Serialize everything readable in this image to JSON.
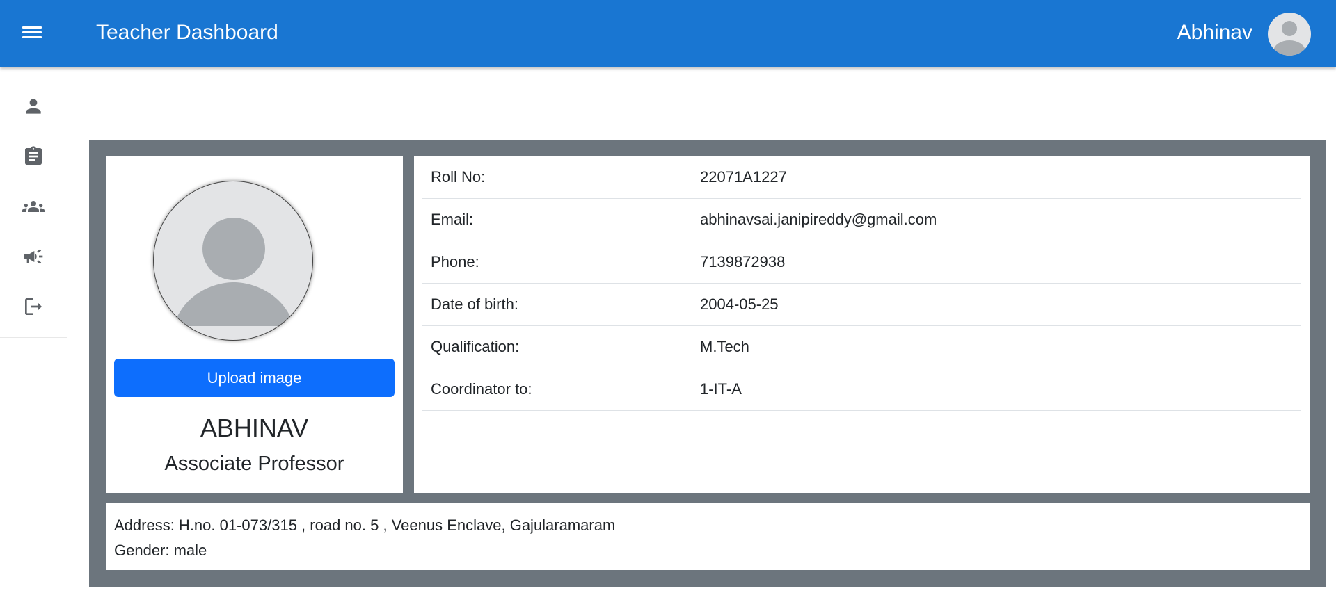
{
  "appbar": {
    "title": "Teacher Dashboard",
    "user_name": "Abhinav",
    "color": "#1976d2"
  },
  "sidebar": {
    "items": [
      {
        "icon": "person-icon"
      },
      {
        "icon": "clipboard-icon"
      },
      {
        "icon": "groups-icon"
      },
      {
        "icon": "campaign-icon"
      },
      {
        "icon": "logout-icon"
      }
    ]
  },
  "profile": {
    "upload_label": "Upload image",
    "name": "ABHINAV",
    "designation": "Associate Professor",
    "details": [
      {
        "label": "Roll No:",
        "value": "22071A1227"
      },
      {
        "label": "Email:",
        "value": "abhinavsai.janipireddy@gmail.com"
      },
      {
        "label": "Phone:",
        "value": "7139872938"
      },
      {
        "label": "Date of birth:",
        "value": "2004-05-25"
      },
      {
        "label": "Qualification:",
        "value": "M.Tech"
      },
      {
        "label": "Coordinator to:",
        "value": "1-IT-A"
      }
    ],
    "address": "Address: H.no. 01-073/315 , road no. 5 , Veenus Enclave, Gajularamaram",
    "gender": "Gender: male"
  },
  "colors": {
    "frame": "#6c757d",
    "button": "#0d6efd"
  }
}
